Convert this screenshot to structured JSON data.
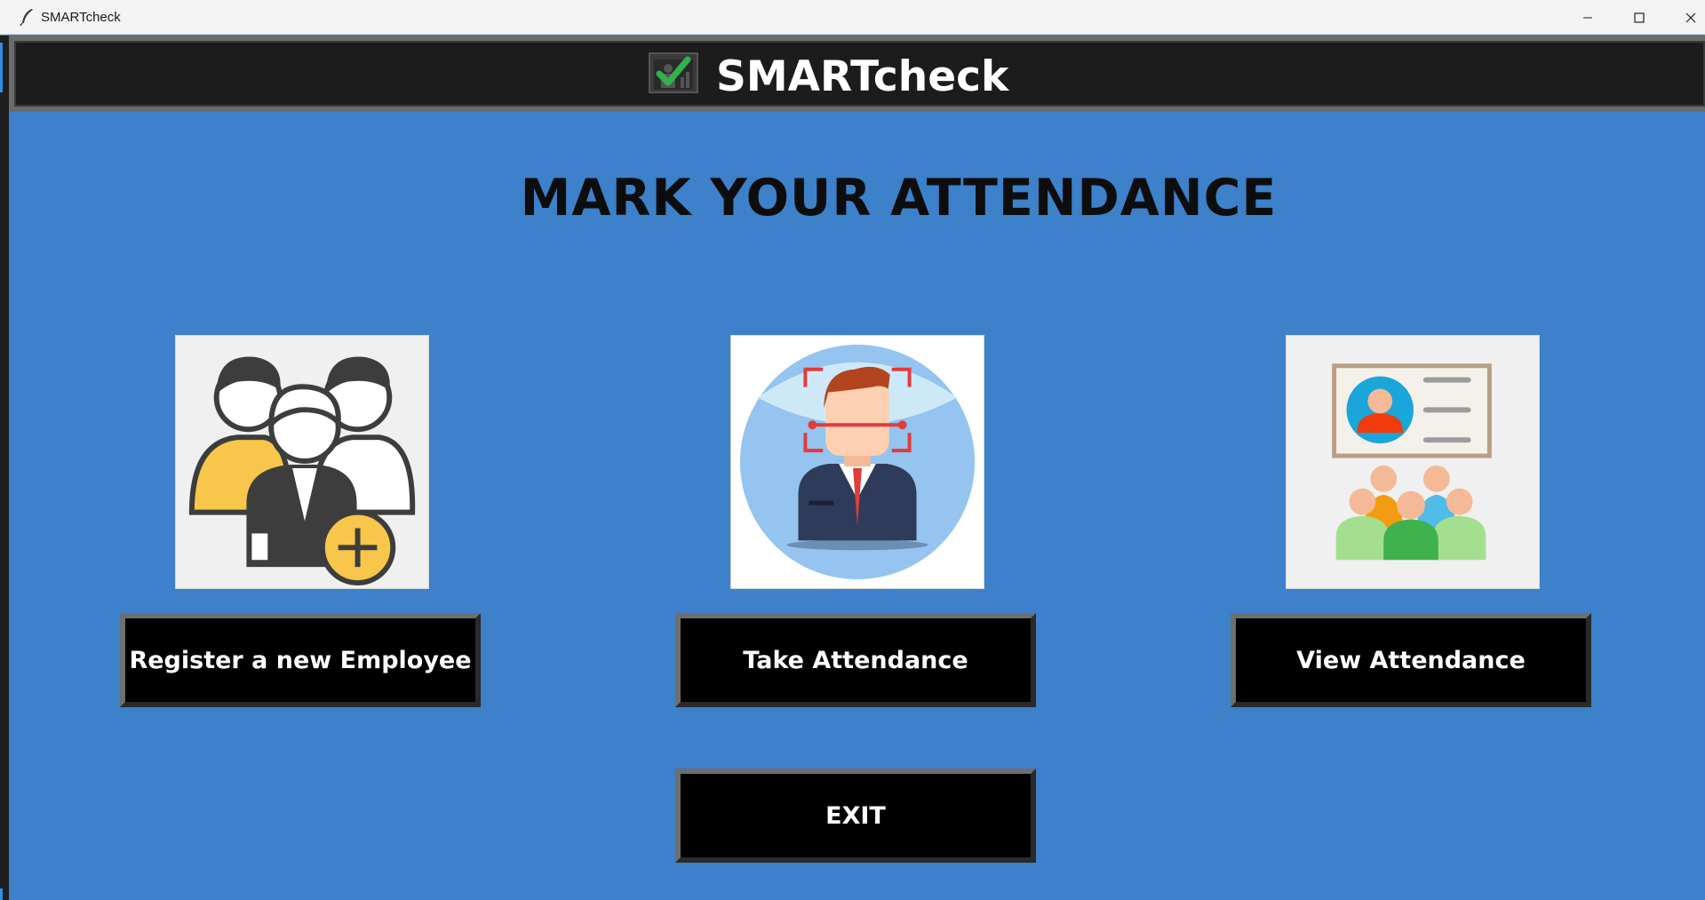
{
  "window": {
    "title": "SMARTcheck"
  },
  "header": {
    "app_name": "SMARTcheck",
    "logo_icon": "attendance-check-icon"
  },
  "main": {
    "heading": "MARK YOUR ATTENDANCE",
    "cards": [
      {
        "icon": "register-employee-icon",
        "button_label": "Register a new Employee"
      },
      {
        "icon": "face-recognition-icon",
        "button_label": "Take Attendance"
      },
      {
        "icon": "view-attendance-icon",
        "button_label": "View Attendance"
      }
    ],
    "exit_label": "EXIT"
  },
  "colors": {
    "background": "#3c81c9",
    "header_bar": "#1c1c1c",
    "button": "#000000",
    "button_text": "#ffffff",
    "heading_text": "#0d0d0d"
  }
}
